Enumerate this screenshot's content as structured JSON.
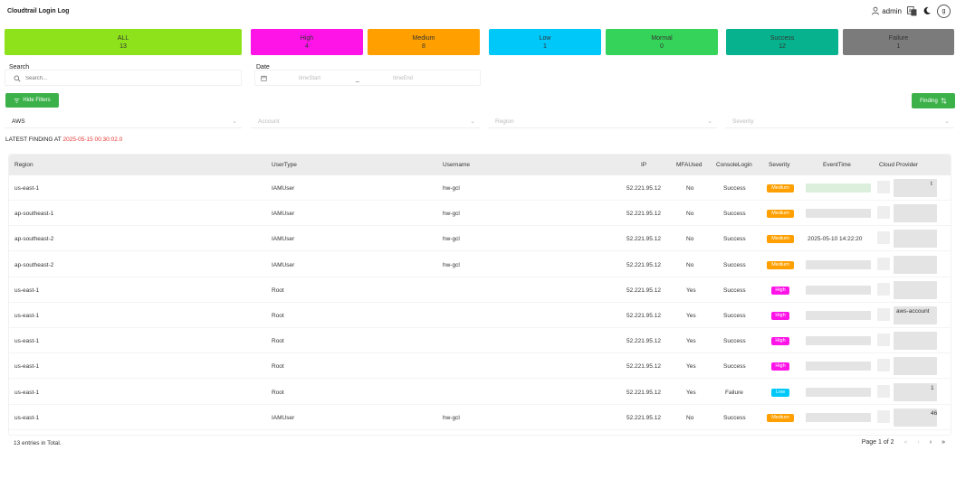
{
  "app": {
    "title": "Cloudtrail Login Log"
  },
  "header": {
    "username": "admin",
    "avatar_letter": "g"
  },
  "colors": {
    "all": "#8ee21b",
    "high": "#ff14e8",
    "medium": "#ffa000",
    "low": "#00c8f8",
    "normal": "#35d35a",
    "success": "#07b38e",
    "failure": "#7b7b7b",
    "accent_green": "#3cb149",
    "timestamp_red": "#e53935"
  },
  "cards": [
    {
      "label": "ALL",
      "count": "13"
    },
    {
      "label": "High",
      "count": "4"
    },
    {
      "label": "Medium",
      "count": "8"
    },
    {
      "label": "Low",
      "count": "1"
    },
    {
      "label": "Mormal",
      "count": "0"
    },
    {
      "label": "Success",
      "count": "12"
    },
    {
      "label": "Failure",
      "count": "1"
    }
  ],
  "filters": {
    "search_label": "Search",
    "search_placeholder": "Search...",
    "date_label": "Date",
    "time_start": "timeStart",
    "time_sep": "_",
    "time_end": "timeEnd",
    "hide_filters": "Hide Filters",
    "finding": "Finding"
  },
  "selects": {
    "provider": "AWS",
    "account": "Account",
    "region": "Region",
    "severity": "Severity"
  },
  "latest": {
    "label": "LATEST FINDING AT",
    "timestamp": "2025-05-15 00:30:02.0"
  },
  "table": {
    "headers": {
      "region": "Region",
      "usertype": "UserType",
      "username": "Username",
      "ip": "IP",
      "mfa": "MFAUsed",
      "console": "ConsoleLogin",
      "severity": "Severity",
      "eventtime": "EventTime",
      "cloud": "Cloud Provider"
    },
    "rows": [
      {
        "region": "us-east-1",
        "usertype": "IAMUser",
        "username": "hw-gcl",
        "ip": "52.221.95.12",
        "mfa": "No",
        "console": "Success",
        "severity": "Medium",
        "eventtime": "",
        "cloud_fragment": "t"
      },
      {
        "region": "ap-southeast-1",
        "usertype": "IAMUser",
        "username": "hw-gcl",
        "ip": "52.221.95.12",
        "mfa": "No",
        "console": "Success",
        "severity": "Medium",
        "eventtime": "",
        "cloud_fragment": ""
      },
      {
        "region": "ap-southeast-2",
        "usertype": "IAMUser",
        "username": "hw-gcl",
        "ip": "52.221.95.12",
        "mfa": "No",
        "console": "Success",
        "severity": "Medium",
        "eventtime": "2025-05-10 14:22:20",
        "cloud_fragment": ""
      },
      {
        "region": "ap-southeast-2",
        "usertype": "IAMUser",
        "username": "hw-gcl",
        "ip": "52.221.95.12",
        "mfa": "No",
        "console": "Success",
        "severity": "Medium",
        "eventtime": "",
        "cloud_fragment": ""
      },
      {
        "region": "us-east-1",
        "usertype": "Root",
        "username": "",
        "ip": "52.221.95.12",
        "mfa": "Yes",
        "console": "Success",
        "severity": "High",
        "eventtime": "",
        "cloud_fragment": ""
      },
      {
        "region": "us-east-1",
        "usertype": "Root",
        "username": "",
        "ip": "52.221.95.12",
        "mfa": "Yes",
        "console": "Success",
        "severity": "High",
        "eventtime": "",
        "cloud_fragment": "aws-account"
      },
      {
        "region": "us-east-1",
        "usertype": "Root",
        "username": "",
        "ip": "52.221.95.12",
        "mfa": "Yes",
        "console": "Success",
        "severity": "High",
        "eventtime": "",
        "cloud_fragment": ""
      },
      {
        "region": "us-east-1",
        "usertype": "Root",
        "username": "",
        "ip": "52.221.95.12",
        "mfa": "Yes",
        "console": "Success",
        "severity": "High",
        "eventtime": "",
        "cloud_fragment": ""
      },
      {
        "region": "us-east-1",
        "usertype": "Root",
        "username": "",
        "ip": "52.221.95.12",
        "mfa": "Yes",
        "console": "Failure",
        "severity": "Low",
        "eventtime": "",
        "cloud_fragment": "1"
      },
      {
        "region": "us-east-1",
        "usertype": "IAMUser",
        "username": "hw-gcl",
        "ip": "52.221.95.12",
        "mfa": "No",
        "console": "Success",
        "severity": "Medium",
        "eventtime": "",
        "cloud_fragment": "46"
      }
    ]
  },
  "footer": {
    "total": "13 entries in Total.",
    "page_info": "Page 1 of 2"
  }
}
